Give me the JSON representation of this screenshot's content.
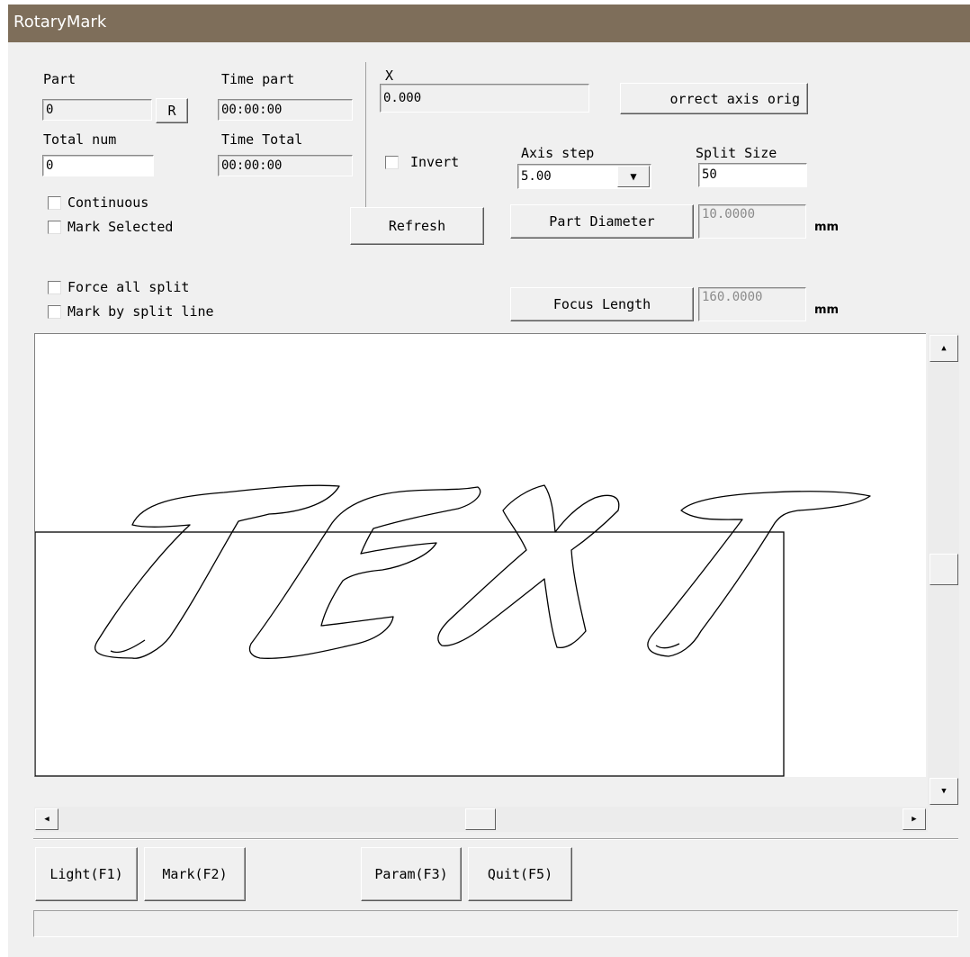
{
  "window": {
    "title": "RotaryMark"
  },
  "part": {
    "label": "Part",
    "value": "0",
    "reset_label": "R"
  },
  "time_part": {
    "label": "Time part",
    "value": "00:00:00"
  },
  "total_num": {
    "label": "Total num",
    "value": "0"
  },
  "time_total": {
    "label": "Time Total",
    "value": "00:00:00"
  },
  "x_axis": {
    "label": "X",
    "value": "0.000",
    "correct_button": "orrect axis orig"
  },
  "invert": {
    "label": "Invert",
    "checked": false
  },
  "axis_step": {
    "label": "Axis step",
    "value": "5.00"
  },
  "split_size": {
    "label": "Split Size",
    "value": "50"
  },
  "options": {
    "continuous": "Continuous",
    "mark_selected": "Mark Selected",
    "force_all_split": "Force all split",
    "mark_by_split_line": "Mark by split line"
  },
  "refresh_button": "Refresh",
  "part_diameter": {
    "button": "Part Diameter",
    "value": "10.0000",
    "unit": "mm"
  },
  "focus_length": {
    "button": "Focus Length",
    "value": "160.0000",
    "unit": "mm"
  },
  "bottom_buttons": {
    "light": "Light(F1)",
    "mark": "Mark(F2)",
    "param": "Param(F3)",
    "quit": "Quit(F5)"
  },
  "icons": {
    "dropdown": "chevron-down-icon",
    "scroll_up": "arrow-up-icon",
    "scroll_down": "arrow-down-icon",
    "scroll_left": "arrow-left-icon",
    "scroll_right": "arrow-right-icon"
  },
  "colors": {
    "titlebar": "#7e6e5a",
    "face": "#f0f0f0"
  }
}
